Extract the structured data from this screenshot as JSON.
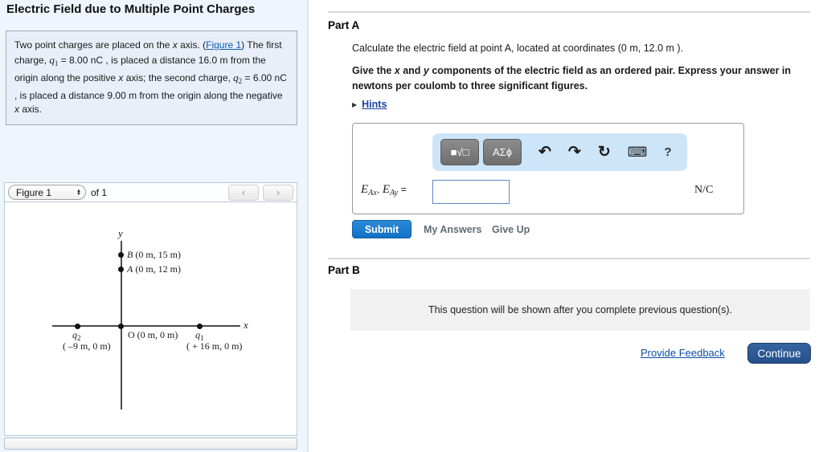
{
  "left": {
    "title": "Electric Field due to Multiple Point Charges",
    "problem": {
      "p1": "Two point charges are placed on the ",
      "x1": "x",
      "p2": " axis. (",
      "figure_link": "Figure 1",
      "p3": ") The first charge, ",
      "q1_sym": "q",
      "q1_sub": "1",
      "p4": " = 8.00 nC , is placed a distance 16.0 m from the origin along the positive ",
      "x2": "x",
      "p5": " axis; the second charge, ",
      "q2_sym": "q",
      "q2_sub": "2",
      "p6": " = 6.00 nC , is placed a distance 9.00 m from the origin along the negative ",
      "x3": "x",
      "p7": " axis."
    },
    "figure_bar": {
      "select_value": "Figure 1",
      "select_up_icon": "▲",
      "select_down_icon": "▼",
      "of_label": "of 1",
      "prev_icon": "‹",
      "next_icon": "›"
    },
    "figure": {
      "y_axis_label": "y",
      "x_axis_label": "x",
      "point_B_letter": "B",
      "point_B_coords": "(0 m, 15 m)",
      "point_A_letter": "A",
      "point_A_coords": "(0 m, 12 m)",
      "origin_letter": "O",
      "origin_coords": "(0 m, 0 m)",
      "q1_letter": "q",
      "q1_sub": "1",
      "q1_coords": "( + 16 m, 0 m)",
      "q2_letter": "q",
      "q2_sub": "2",
      "q2_coords": "( –9 m, 0 m)"
    }
  },
  "part_a": {
    "heading": "Part A",
    "prompt": "Calculate the electric field at point A, located at coordinates (0 m, 12.0 m ).",
    "instr_1": "Give the ",
    "instr_x": "x",
    "instr_2": " and ",
    "instr_y": "y",
    "instr_3": " components of the electric field as an ordered pair. Express your answer in newtons per coulomb to three significant figures.",
    "hints_arrow": "▶",
    "hints_label": "Hints",
    "toolbar": {
      "templates_icon": "■√□",
      "greek_icon": "ΑΣϕ",
      "undo_icon": "↶",
      "redo_icon": "↷",
      "reset_icon": "↻",
      "keyboard_icon": "⌨",
      "help_icon": "?"
    },
    "answer": {
      "e_sym": "E",
      "x_sub": "Ax",
      "comma": ",",
      "y_sub": "Ay",
      "equals": "=",
      "input_value": "",
      "unit": "N/C"
    },
    "submit_label": "Submit",
    "my_answers_label": "My Answers",
    "give_up_label": "Give Up"
  },
  "part_b": {
    "heading": "Part B",
    "locked_message": "This question will be shown after you complete previous question(s)."
  },
  "footer": {
    "provide_feedback_label": "Provide Feedback",
    "continue_label": "Continue"
  },
  "colors": {
    "left_panel_bg": "#eff5fd",
    "problem_box_bg": "#e9eff9",
    "toolbar_bg": "#cde5f8",
    "submit_blue": "#1170c4",
    "continue_blue": "#26508b",
    "link_blue": "#0b5bb5"
  }
}
